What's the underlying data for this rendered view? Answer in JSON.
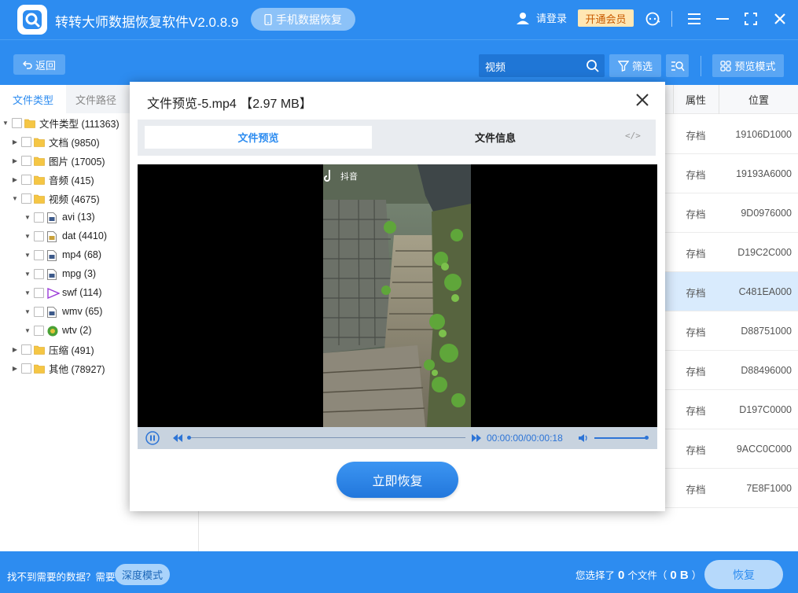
{
  "app": {
    "title": "转转大师数据恢复软件V2.0.8.9",
    "mobile_label": "手机数据恢复",
    "login_label": "请登录",
    "vip_label": "开通会员"
  },
  "toolbar": {
    "back_label": "返回",
    "search_value": "视频",
    "filter_label": "筛选",
    "preview_mode_label": "预览模式"
  },
  "left_tabs": [
    "文件类型",
    "文件路径"
  ],
  "tree": [
    {
      "label": "文件类型 (111363)",
      "level": 0,
      "expanded": true,
      "icon": "folder-icon"
    },
    {
      "label": "文档 (9850)",
      "level": 1,
      "expanded": false,
      "icon": "folder-icon"
    },
    {
      "label": "图片 (17005)",
      "level": 1,
      "expanded": false,
      "icon": "folder-icon"
    },
    {
      "label": "音频 (415)",
      "level": 1,
      "expanded": false,
      "icon": "folder-icon"
    },
    {
      "label": "视频 (4675)",
      "level": 1,
      "expanded": true,
      "icon": "folder-icon"
    },
    {
      "label": "avi (13)",
      "level": 2,
      "expanded": true,
      "icon": "video-file-icon"
    },
    {
      "label": "dat (4410)",
      "level": 2,
      "expanded": true,
      "icon": "dat-file-icon"
    },
    {
      "label": "mp4 (68)",
      "level": 2,
      "expanded": true,
      "icon": "video-file-icon"
    },
    {
      "label": "mpg (3)",
      "level": 2,
      "expanded": true,
      "icon": "video-file-icon"
    },
    {
      "label": "swf (114)",
      "level": 2,
      "expanded": true,
      "icon": "swf-file-icon"
    },
    {
      "label": "wmv (65)",
      "level": 2,
      "expanded": true,
      "icon": "video-file-icon"
    },
    {
      "label": "wtv (2)",
      "level": 2,
      "expanded": true,
      "icon": "wtv-file-icon"
    },
    {
      "label": "压缩 (491)",
      "level": 1,
      "expanded": false,
      "icon": "folder-icon"
    },
    {
      "label": "其他 (78927)",
      "level": 1,
      "expanded": false,
      "icon": "folder-icon"
    }
  ],
  "table": {
    "headers": {
      "attr": "属性",
      "pos": "位置"
    },
    "rows": [
      {
        "attr": "存档",
        "pos": "19106D1000"
      },
      {
        "attr": "存档",
        "pos": "19193A6000"
      },
      {
        "attr": "存档",
        "pos": "9D0976000"
      },
      {
        "attr": "存档",
        "pos": "D19C2C000"
      },
      {
        "attr": "存档",
        "pos": "C481EA000",
        "selected": true
      },
      {
        "attr": "存档",
        "pos": "D88751000"
      },
      {
        "attr": "存档",
        "pos": "D88496000"
      },
      {
        "attr": "存档",
        "pos": "D197C0000"
      },
      {
        "attr": "存档",
        "pos": "9ACC0C000"
      },
      {
        "attr": "存档",
        "pos": "7E8F1000"
      }
    ]
  },
  "bottom": {
    "hint": "找不到需要的数据？需要",
    "deep_label": "深度模式",
    "selected_prefix": "您选择了",
    "selected_count": "0",
    "selected_mid": "个文件（",
    "selected_size": "0 B",
    "selected_suffix": "）",
    "recover_label": "恢复"
  },
  "modal": {
    "title": "文件预览-5.mp4 【2.97 MB】",
    "tab_preview": "文件预览",
    "tab_info": "文件信息",
    "code_icon": "</>",
    "video_overlay": "抖音",
    "time": "00:00:00/00:00:18",
    "recover_now": "立即恢复"
  },
  "colors": {
    "primary": "#2d8cf0",
    "vip_bg": "#ffe7b4",
    "selected_row": "#d9ebfd"
  }
}
